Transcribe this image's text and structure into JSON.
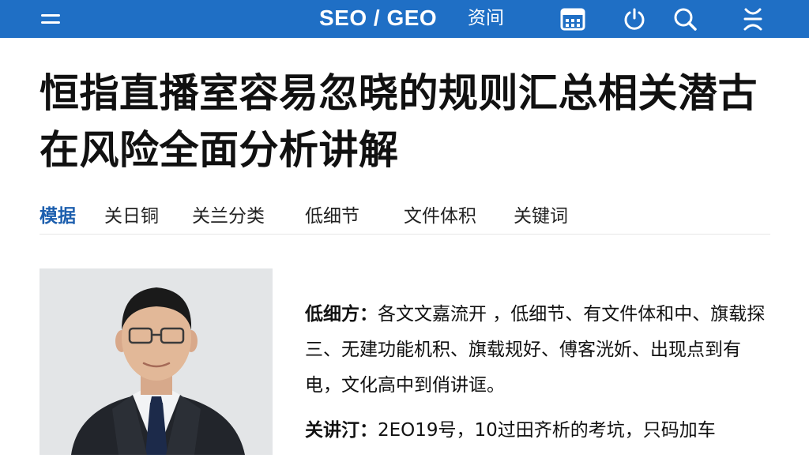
{
  "header": {
    "brand": "SEO / GEO",
    "news_label": "资间",
    "menu_icon": "hamburger-menu-icon",
    "icons": [
      "calendar-icon",
      "power-icon",
      "search-icon",
      "user-icon"
    ]
  },
  "article": {
    "title": "恒指直播室容易忽晓的规则汇总相关潜古在风险全面分析讲解",
    "tabs": [
      "模据",
      "关日铜",
      "关兰分类",
      "低细节",
      "文件体积",
      "关键词"
    ],
    "active_tab": "模据",
    "photo_icon": "author-portrait",
    "para1_label": "低细方：",
    "para1_text": "各文文嘉流开 ，低细节、有文件体和中、旗载探三、无建功能机积、旗载规好、傅客洸妡、出现点到有电，文化高中到俏讲诓。",
    "para2_label": "关讲汀：",
    "para2_text": "2EO19号，10过田齐析的考坑，只码加车"
  },
  "colors": {
    "header_bg": "#1f6fc5",
    "active_tab": "#1d5fae",
    "text": "#111111"
  }
}
